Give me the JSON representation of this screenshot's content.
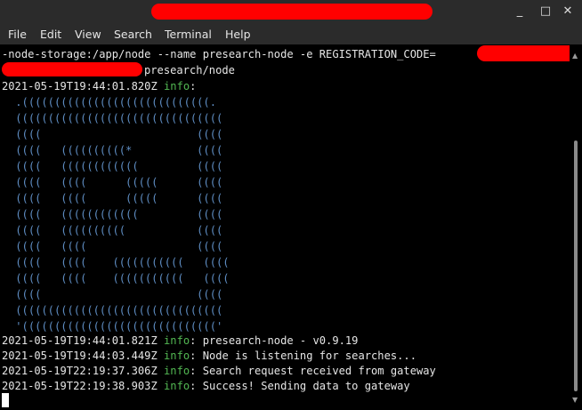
{
  "window": {
    "buttons": {
      "minimize": "_",
      "maximize": "□",
      "close": "✕"
    }
  },
  "menu": {
    "file": "File",
    "edit": "Edit",
    "view": "View",
    "search": "Search",
    "terminal": "Terminal",
    "help": "Help"
  },
  "terminal": {
    "command_line_1": "-node-storage:/app/node --name presearch-node -e REGISTRATION_CODE=",
    "command_line_2": "presearch/node",
    "log_header": {
      "timestamp": "2021-05-19T19:44:01.820Z",
      "level": "info",
      "sep": ":"
    },
    "ascii_art": [
      " .(((((((((((((((((((((((((((((.",
      " ((((((((((((((((((((((((((((((((",
      " ((((                        ((((",
      " ((((   ((((((((((*          ((((",
      " ((((   ((((((((((((         ((((",
      " ((((   ((((      (((((      ((((",
      " ((((   ((((      (((((      ((((",
      " ((((   ((((((((((((         ((((",
      " ((((   ((((((((((           ((((",
      " ((((   ((((                 ((((",
      " ((((   ((((    (((((((((((   ((((",
      " ((((   ((((    (((((((((((   ((((",
      " ((((                        ((((",
      " ((((((((((((((((((((((((((((((((",
      " '(((((((((((((((((((((((((((((('"
    ],
    "logs": [
      {
        "timestamp": "2021-05-19T19:44:01.821Z",
        "level": "info",
        "message": "presearch-node - v0.9.19"
      },
      {
        "timestamp": "2021-05-19T19:44:03.449Z",
        "level": "info",
        "message": "Node is listening for searches..."
      },
      {
        "timestamp": "2021-05-19T22:19:37.306Z",
        "level": "info",
        "message": "Search request received from gateway"
      },
      {
        "timestamp": "2021-05-19T22:19:38.903Z",
        "level": "info",
        "message": "Success! Sending data to gateway"
      }
    ]
  },
  "colors": {
    "background": "#000000",
    "chrome": "#2b2b2b",
    "text": "#e6e6e6",
    "info": "#53b853",
    "ascii": "#5f8ec4",
    "redaction": "#ff0000"
  }
}
